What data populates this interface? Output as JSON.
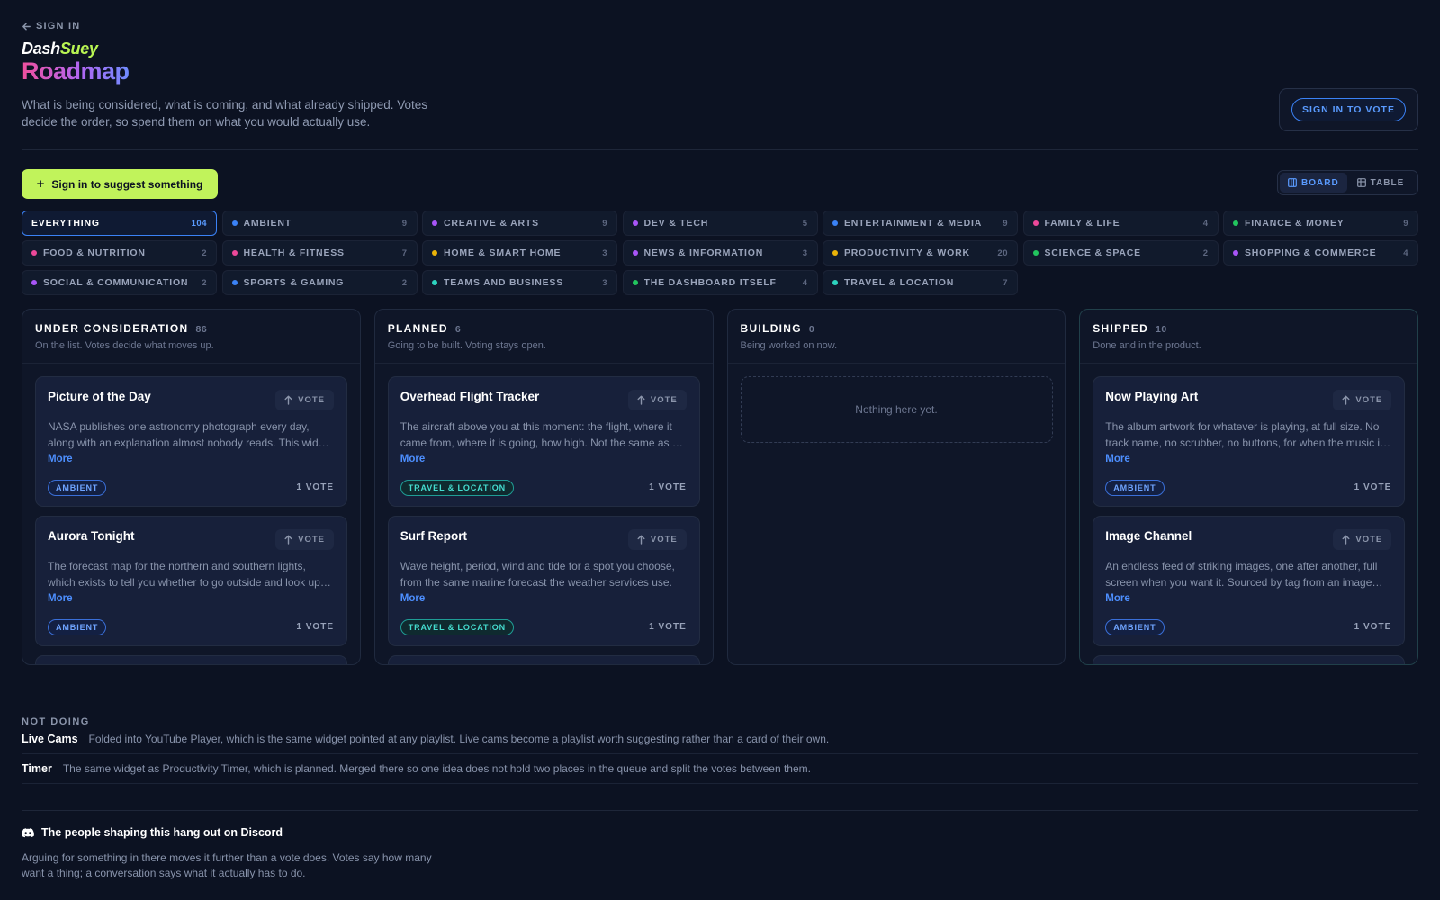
{
  "nav": {
    "back_label": "SIGN IN"
  },
  "brand": {
    "part1": "Dash",
    "part2": "Suey"
  },
  "page": {
    "title": "Roadmap",
    "subtitle": "What is being considered, what is coming, and what already shipped. Votes decide the order, so spend them on what you would actually use.",
    "sign_in_vote_label": "SIGN IN TO VOTE",
    "suggest_label": "Sign in to suggest something"
  },
  "view": {
    "board_label": "BOARD",
    "table_label": "TABLE",
    "active": "board"
  },
  "colors": {
    "accent": "#3b82f6",
    "lime": "#c1f35b",
    "background": "#0c1222"
  },
  "categories": [
    {
      "label": "EVERYTHING",
      "count": "104",
      "color": "",
      "active": true
    },
    {
      "label": "AMBIENT",
      "count": "9",
      "color": "#3b82f6"
    },
    {
      "label": "CREATIVE & ARTS",
      "count": "9",
      "color": "#a855f7"
    },
    {
      "label": "DEV & TECH",
      "count": "5",
      "color": "#a855f7"
    },
    {
      "label": "ENTERTAINMENT & MEDIA",
      "count": "9",
      "color": "#3b82f6"
    },
    {
      "label": "FAMILY & LIFE",
      "count": "4",
      "color": "#ec4899"
    },
    {
      "label": "FINANCE & MONEY",
      "count": "9",
      "color": "#22c55e"
    },
    {
      "label": "FOOD & NUTRITION",
      "count": "2",
      "color": "#ec4899"
    },
    {
      "label": "HEALTH & FITNESS",
      "count": "7",
      "color": "#ec4899"
    },
    {
      "label": "HOME & SMART HOME",
      "count": "3",
      "color": "#eab308"
    },
    {
      "label": "NEWS & INFORMATION",
      "count": "3",
      "color": "#a855f7"
    },
    {
      "label": "PRODUCTIVITY & WORK",
      "count": "20",
      "color": "#eab308"
    },
    {
      "label": "SCIENCE & SPACE",
      "count": "2",
      "color": "#22c55e"
    },
    {
      "label": "SHOPPING & COMMERCE",
      "count": "4",
      "color": "#a855f7"
    },
    {
      "label": "SOCIAL & COMMUNICATION",
      "count": "2",
      "color": "#a855f7"
    },
    {
      "label": "SPORTS & GAMING",
      "count": "2",
      "color": "#3b82f6"
    },
    {
      "label": "TEAMS AND BUSINESS",
      "count": "3",
      "color": "#2dd4bf"
    },
    {
      "label": "THE DASHBOARD ITSELF",
      "count": "4",
      "color": "#22c55e"
    },
    {
      "label": "TRAVEL & LOCATION",
      "count": "7",
      "color": "#2dd4bf"
    }
  ],
  "columns": [
    {
      "key": "under",
      "title": "UNDER CONSIDERATION",
      "count": "86",
      "desc": "On the list. Votes decide what moves up.",
      "cards": [
        {
          "title": "Picture of the Day",
          "desc": "NASA publishes one astronomy photograph every day, along with an explanation almost nobody reads. This widget shows it large.",
          "tag": "AMBIENT",
          "tag_style": "ambient",
          "votes": "1 VOTE"
        },
        {
          "title": "Aurora Tonight",
          "desc": "The forecast map for the northern and southern lights, which exists to tell you whether to go outside and look up tonight.",
          "tag": "AMBIENT",
          "tag_style": "ambient",
          "votes": "1 VOTE"
        }
      ]
    },
    {
      "key": "planned",
      "title": "PLANNED",
      "count": "6",
      "desc": "Going to be built. Voting stays open.",
      "cards": [
        {
          "title": "Overhead Flight Tracker",
          "desc": "The aircraft above you at this moment: the flight, where it came from, where it is going, how high. Not the same as a map.",
          "tag": "TRAVEL & LOCATION",
          "tag_style": "travel",
          "votes": "1 VOTE"
        },
        {
          "title": "Surf Report",
          "desc": "Wave height, period, wind and tide for a spot you choose, from the same marine forecast the weather services use.",
          "tag": "TRAVEL & LOCATION",
          "tag_style": "travel",
          "votes": "1 VOTE"
        }
      ]
    },
    {
      "key": "building",
      "title": "BUILDING",
      "count": "0",
      "desc": "Being worked on now.",
      "empty": "Nothing here yet.",
      "cards": []
    },
    {
      "key": "shipped",
      "title": "SHIPPED",
      "count": "10",
      "desc": "Done and in the product.",
      "cards": [
        {
          "title": "Now Playing Art",
          "desc": "The album artwork for whatever is playing, at full size. No track name, no scrubber, no buttons, for when the music is the point.",
          "tag": "AMBIENT",
          "tag_style": "ambient",
          "votes": "1 VOTE"
        },
        {
          "title": "Image Channel",
          "desc": "An endless feed of striking images, one after another, full screen when you want it. Sourced by tag from an image service.",
          "tag": "AMBIENT",
          "tag_style": "ambient",
          "votes": "1 VOTE"
        }
      ]
    }
  ],
  "card_labels": {
    "vote": "VOTE",
    "more": "More"
  },
  "not_doing": {
    "title": "NOT DOING",
    "items": [
      {
        "name": "Live Cams",
        "text": "Folded into YouTube Player, which is the same widget pointed at any playlist. Live cams become a playlist worth suggesting rather than a card of their own."
      },
      {
        "name": "Timer",
        "text": "The same widget as Productivity Timer, which is planned. Merged there so one idea does not hold two places in the queue and split the votes between them."
      }
    ]
  },
  "discord": {
    "title": "The people shaping this hang out on Discord",
    "desc": "Arguing for something in there moves it further than a vote does. Votes say how many want a thing; a conversation says what it actually has to do."
  }
}
